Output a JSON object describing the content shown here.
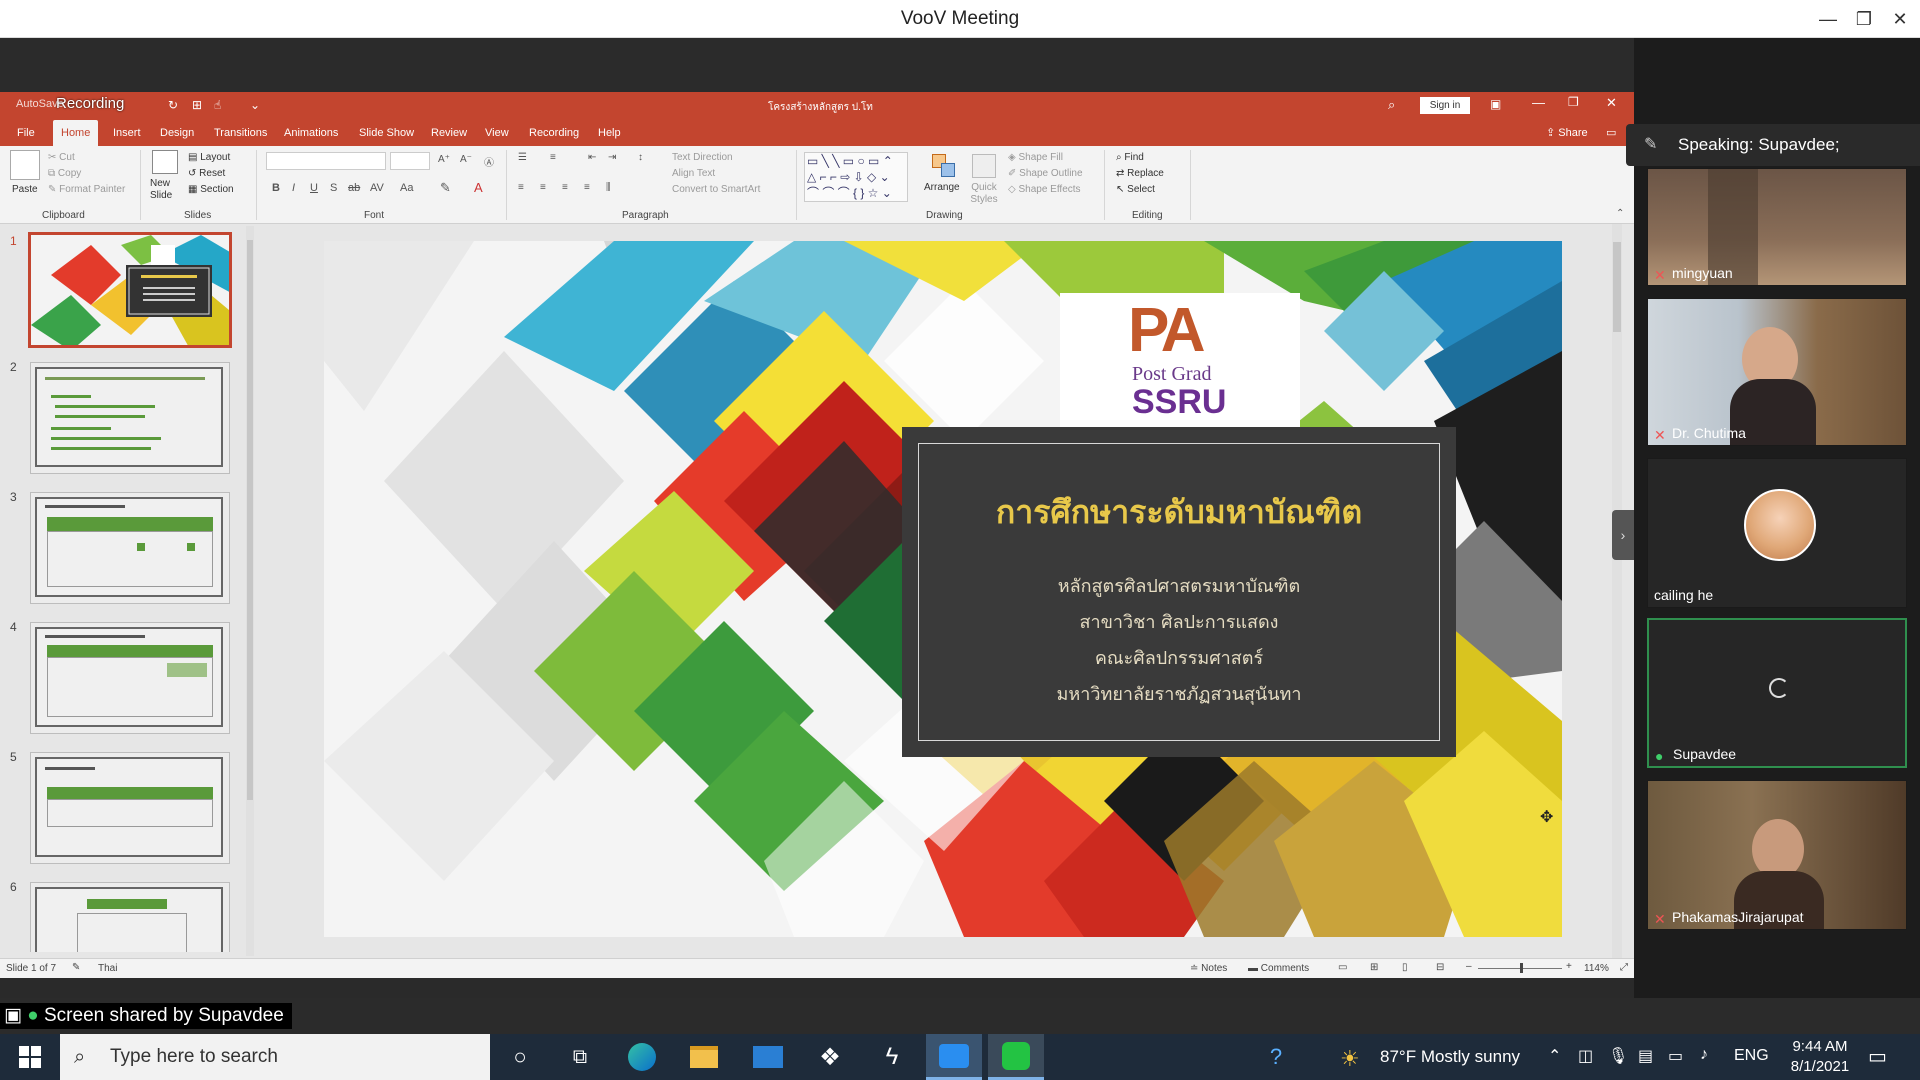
{
  "window": {
    "title": "VooV Meeting",
    "minimize": "—",
    "restore": "❐",
    "close": "✕"
  },
  "ppt": {
    "quick_access": "AutoSave",
    "recording_badge": "Recording",
    "doc_title": "โครงสร้างหลักสูตร ป.โท",
    "sign_in": "Sign in",
    "share": "Share",
    "tabs": [
      "File",
      "Home",
      "Insert",
      "Design",
      "Transitions",
      "Animations",
      "Slide Show",
      "Review",
      "View",
      "Recording",
      "Help"
    ],
    "ribbon": {
      "clipboard": {
        "paste": "Paste",
        "cut": "Cut",
        "copy": "Copy",
        "format_painter": "Format Painter",
        "label": "Clipboard"
      },
      "slides": {
        "new_slide": "New Slide",
        "layout": "Layout",
        "reset": "Reset",
        "section": "Section",
        "label": "Slides"
      },
      "font": {
        "label": "Font"
      },
      "paragraph": {
        "text_direction": "Text Direction",
        "align_text": "Align Text",
        "smartart": "Convert to SmartArt",
        "label": "Paragraph"
      },
      "drawing": {
        "arrange": "Arrange",
        "quick_styles": "Quick Styles",
        "shape_fill": "Shape Fill",
        "shape_outline": "Shape Outline",
        "shape_effects": "Shape Effects",
        "label": "Drawing"
      },
      "editing": {
        "find": "Find",
        "replace": "Replace",
        "select": "Select",
        "label": "Editing"
      }
    },
    "thumbnails": [
      "1",
      "2",
      "3",
      "4",
      "5",
      "6"
    ],
    "slide": {
      "logo_main": "PA",
      "logo_sub": "Post Grad",
      "logo_org": "SSRU",
      "title": "การศึกษาระดับมหาบัณฑิต",
      "lines": [
        "หลักสูตรศิลปศาสตรมหาบัณฑิต",
        "สาขาวิชา ศิลปะการแสดง",
        "คณะศิลปกรรมศาสตร์",
        "มหาวิทยาลัยราชภัฏสวนสุนันทา"
      ]
    },
    "status": {
      "slide_count": "Slide 1 of 7",
      "language": "Thai",
      "notes": "Notes",
      "comments": "Comments",
      "zoom": "114%"
    }
  },
  "meeting": {
    "speaking": "Speaking: Supavdee;",
    "participants": [
      {
        "name": "mingyuan",
        "muted": true
      },
      {
        "name": "Dr. Chutima",
        "muted": true
      },
      {
        "name": "cailing he",
        "muted": false
      },
      {
        "name": "Supavdee",
        "muted": false
      },
      {
        "name": "PhakamasJirajarupat",
        "muted": true
      }
    ],
    "screen_shared": "Screen shared by Supavdee"
  },
  "taskbar": {
    "search_placeholder": "Type here to search",
    "weather": "87°F  Mostly sunny",
    "lang": "ENG",
    "time": "9:44 AM",
    "date": "8/1/2021"
  },
  "colors": {
    "ppt_accent": "#c3452f",
    "speaker_green": "#2f8f4e",
    "slide_title": "#e8c84a"
  }
}
